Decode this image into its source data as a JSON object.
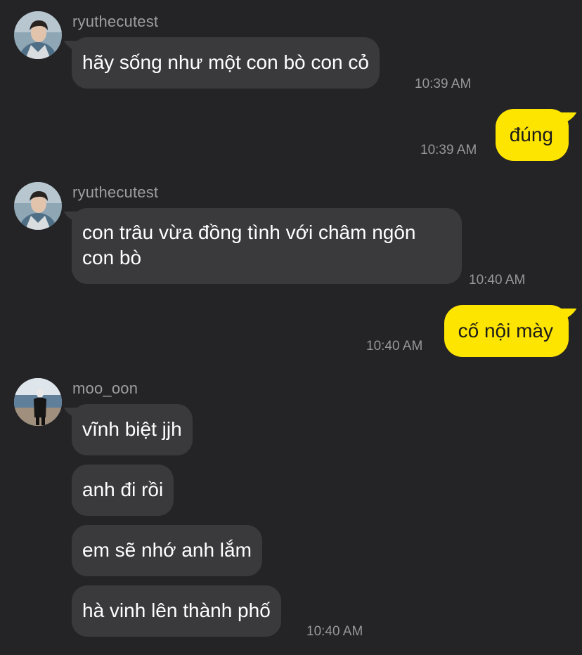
{
  "messages": [
    {
      "sender": "ryuthecutest",
      "text": "hãy sống như một con bò con cỏ",
      "time": "10:39 AM"
    },
    {
      "text": "đúng",
      "time": "10:39 AM"
    },
    {
      "sender": "ryuthecutest",
      "text": "con trâu vừa đồng tình với châm ngôn con bò",
      "time": "10:40 AM"
    },
    {
      "text": "cố nội mày",
      "time": "10:40 AM"
    },
    {
      "sender": "moo_oon",
      "text": "vĩnh biệt jjh"
    },
    {
      "text": "anh đi rồi"
    },
    {
      "text": "em sẽ nhớ anh lắm"
    },
    {
      "text": "hà vinh lên thành phố",
      "time": "10:40 AM"
    }
  ],
  "colors": {
    "background": "#242426",
    "incoming_bubble": "#3a3a3c",
    "outgoing_bubble": "#fee500",
    "meta_text": "#9d9da2"
  }
}
